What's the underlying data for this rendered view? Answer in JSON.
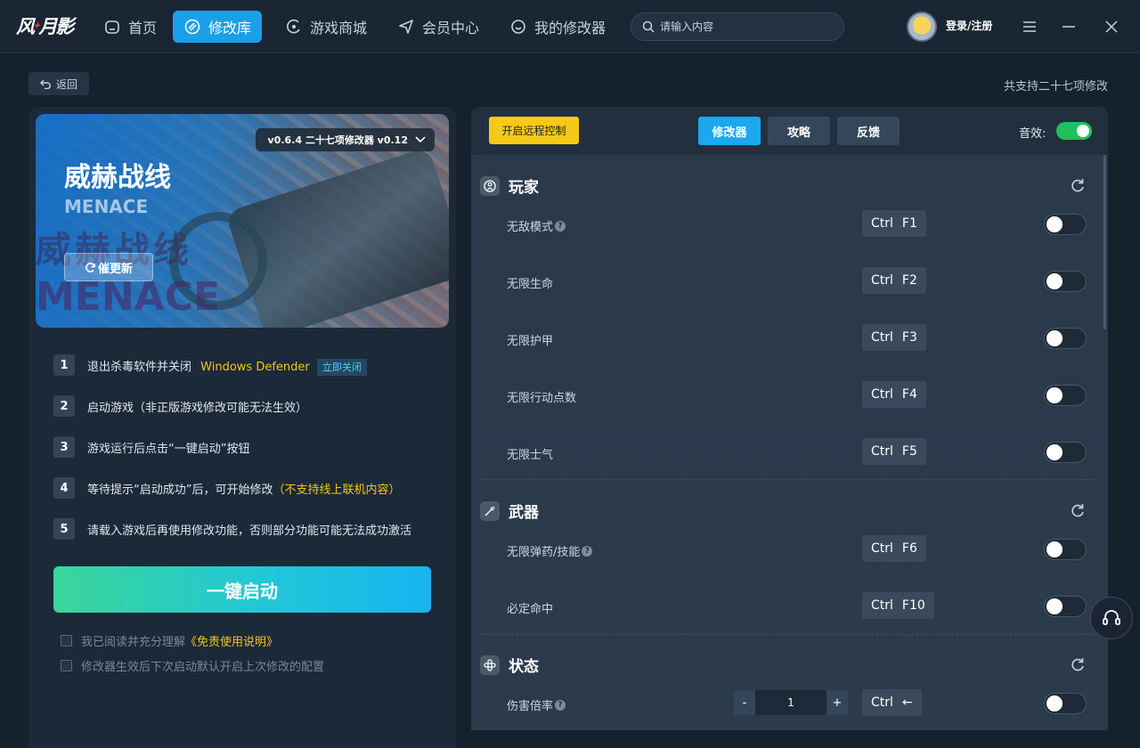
{
  "topbar": {
    "logo_text": "风灵月影",
    "nav": [
      {
        "label": "首页",
        "icon": "home-icon"
      },
      {
        "label": "修改库",
        "icon": "library-icon",
        "active": true
      },
      {
        "label": "游戏商城",
        "icon": "store-icon"
      },
      {
        "label": "会员中心",
        "icon": "member-icon"
      },
      {
        "label": "我的修改器",
        "icon": "my-trainer-icon"
      }
    ],
    "search_placeholder": "请输入内容",
    "login_label": "登录/注册"
  },
  "subheader": {
    "back_label": "返回",
    "support_count": "共支持二十七项修改"
  },
  "game": {
    "title": "威赫战线",
    "subtitle": "MENACE",
    "bg_text_cn": "威赫战线",
    "bg_text_en": "MENACE",
    "update_label": "催更新",
    "version": "v0.6.4 二十七项修改器 v0.12"
  },
  "steps": [
    {
      "num": "1",
      "text": "退出杀毒软件并关闭",
      "highlight": "Windows Defender",
      "action": "立即关闭"
    },
    {
      "num": "2",
      "text": "启动游戏（非正版游戏修改可能无法生效）"
    },
    {
      "num": "3",
      "text": "游戏运行后点击“一键启动”按钮"
    },
    {
      "num": "4",
      "text": "等待提示“启动成功”后，可开始修改",
      "highlight": "（不支持线上联机内容）"
    },
    {
      "num": "5",
      "text": "请载入游戏后再使用修改功能，否则部分功能可能无法成功激活"
    }
  ],
  "launch_label": "一键启动",
  "checks": {
    "disclaimer_prefix": "我已阅读并充分理解",
    "disclaimer_link": "《免责使用说明》",
    "remember": "修改器生效后下次启动默认开启上次修改的配置"
  },
  "right": {
    "remote_label": "开启远程控制",
    "tabs": [
      "修改器",
      "攻略",
      "反馈"
    ],
    "sound_label": "音效:",
    "sound_on": true
  },
  "sections": [
    {
      "title": "玩家",
      "rows": [
        {
          "label": "无敌模式",
          "help": true,
          "mod": "Ctrl",
          "key": "F1"
        },
        {
          "label": "无限生命",
          "mod": "Ctrl",
          "key": "F2"
        },
        {
          "label": "无限护甲",
          "mod": "Ctrl",
          "key": "F3"
        },
        {
          "label": "无限行动点数",
          "mod": "Ctrl",
          "key": "F4"
        },
        {
          "label": "无限士气",
          "mod": "Ctrl",
          "key": "F5"
        }
      ]
    },
    {
      "title": "武器",
      "rows": [
        {
          "label": "无限弹药/技能",
          "help": true,
          "mod": "Ctrl",
          "key": "F6"
        },
        {
          "label": "必定命中",
          "mod": "Ctrl",
          "key": "F10"
        }
      ]
    },
    {
      "title": "状态",
      "rows": [
        {
          "label": "伤害倍率",
          "help": true,
          "mod": "Ctrl",
          "key": "←",
          "stepper": {
            "minus": "-",
            "value": "1",
            "plus": "+"
          }
        }
      ]
    }
  ],
  "colors": {
    "accent": "#1aa8f0",
    "yellow": "#f5c518",
    "toggle_on": "#21c05c"
  }
}
